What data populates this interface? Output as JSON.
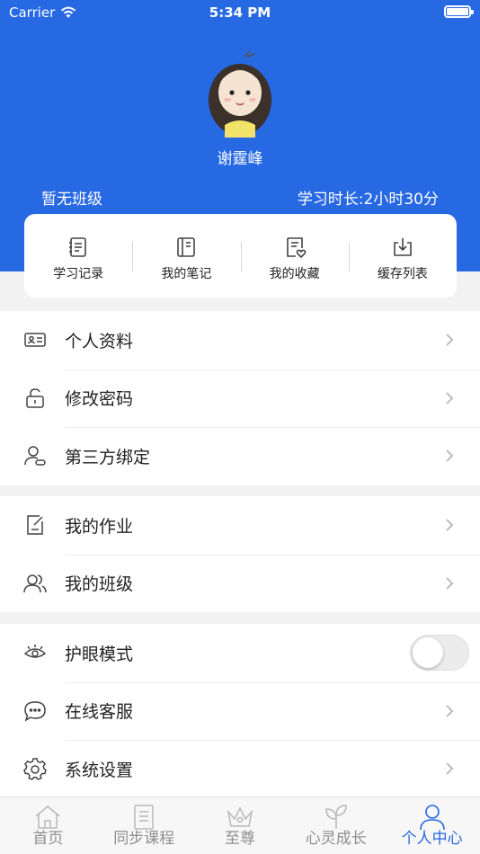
{
  "status_bar": {
    "carrier": "Carrier",
    "time": "5:34 PM",
    "battery_level": 1.0
  },
  "profile": {
    "name": "谢霆峰",
    "class": "暂无班级",
    "study_time": "学习时长:2小时30分"
  },
  "quick_actions": [
    {
      "label": "学习记录",
      "icon": "study-record-icon"
    },
    {
      "label": "我的笔记",
      "icon": "notes-icon"
    },
    {
      "label": "我的收藏",
      "icon": "favorites-icon"
    },
    {
      "label": "缓存列表",
      "icon": "download-icon"
    }
  ],
  "menu_group_1": [
    {
      "label": "个人资料",
      "icon": "id-card-icon"
    },
    {
      "label": "修改密码",
      "icon": "lock-icon"
    },
    {
      "label": "第三方绑定",
      "icon": "user-link-icon"
    }
  ],
  "menu_group_2": [
    {
      "label": "我的作业",
      "icon": "homework-icon"
    },
    {
      "label": "我的班级",
      "icon": "group-icon"
    }
  ],
  "menu_group_3": [
    {
      "label": "护眼模式",
      "icon": "eye-icon",
      "toggle": false
    },
    {
      "label": "在线客服",
      "icon": "chat-icon"
    },
    {
      "label": "系统设置",
      "icon": "settings-icon"
    }
  ],
  "tabbar": {
    "tabs": [
      {
        "label": "首页",
        "icon": "home-icon",
        "active": false
      },
      {
        "label": "同步课程",
        "icon": "book-icon",
        "active": false
      },
      {
        "label": "至尊",
        "icon": "crown-icon",
        "active": false
      },
      {
        "label": "心灵成长",
        "icon": "leaf-icon",
        "active": false
      },
      {
        "label": "个人中心",
        "icon": "person-icon",
        "active": true
      }
    ]
  },
  "colors": {
    "primary": "#2768e3",
    "inactive": "#8e8e8e"
  }
}
